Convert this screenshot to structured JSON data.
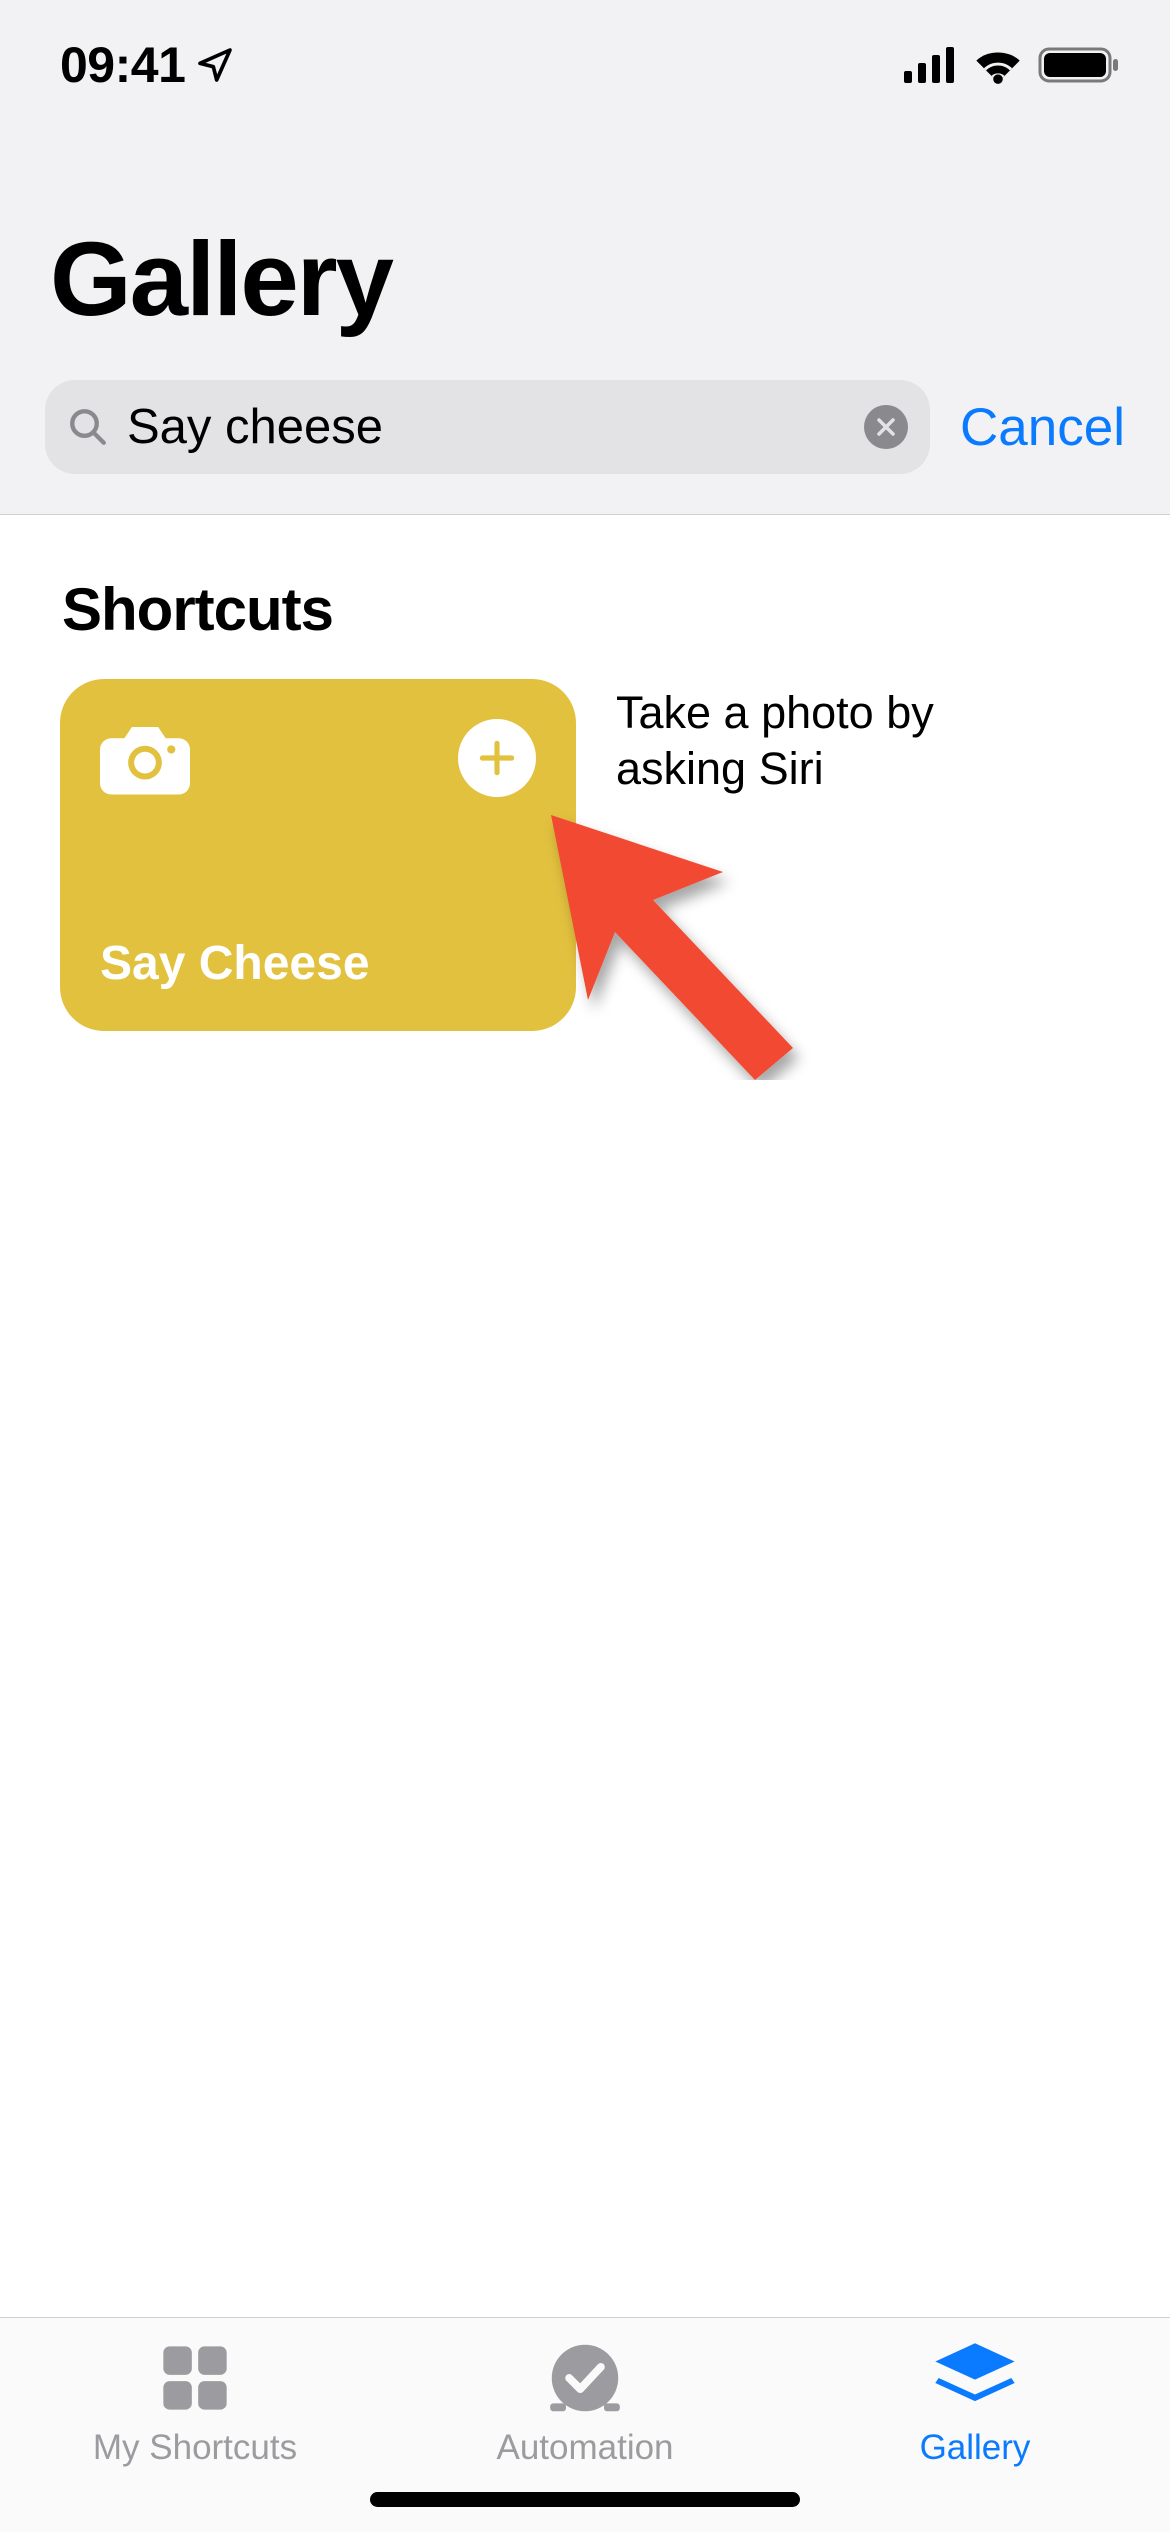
{
  "status": {
    "time": "09:41"
  },
  "page": {
    "title": "Gallery"
  },
  "search": {
    "value": "Say cheese",
    "cancel": "Cancel"
  },
  "section": {
    "title": "Shortcuts"
  },
  "shortcut": {
    "card": {
      "label": "Say Cheese",
      "icon": "camera-icon",
      "color": "#e2c13e"
    },
    "description": "Take a photo by asking Siri"
  },
  "tabs": [
    {
      "label": "My Shortcuts",
      "icon": "grid-icon",
      "active": false
    },
    {
      "label": "Automation",
      "icon": "clock-check-icon",
      "active": false
    },
    {
      "label": "Gallery",
      "icon": "stack-icon",
      "active": true
    }
  ]
}
